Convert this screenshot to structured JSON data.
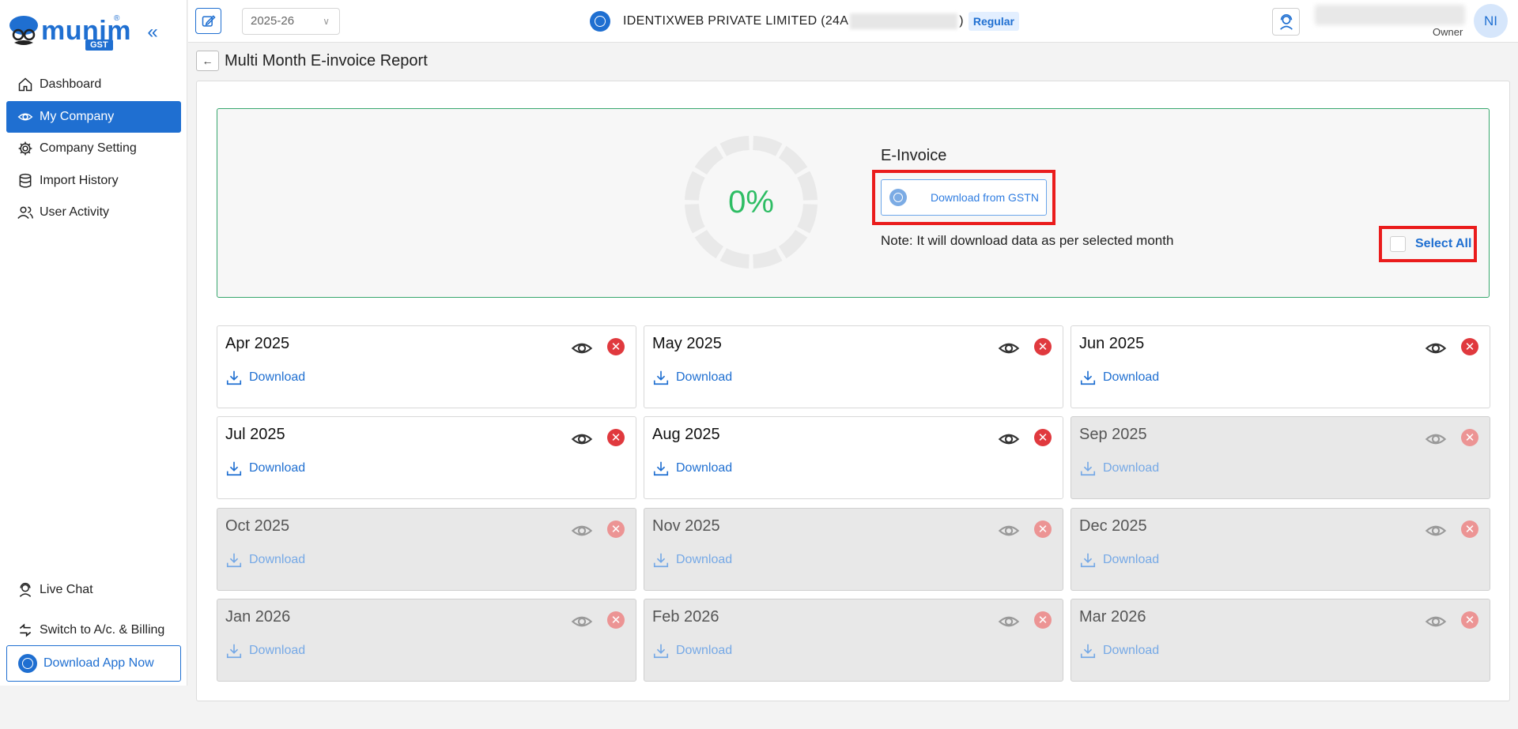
{
  "sidebar": {
    "brand": "munim",
    "brand_tag": "GST",
    "brand_mark": "®",
    "collapse": "«",
    "items": [
      {
        "label": "Dashboard"
      },
      {
        "label": "My Company"
      },
      {
        "label": "Company Setting"
      },
      {
        "label": "Import History"
      },
      {
        "label": "User Activity"
      }
    ],
    "bottom_items": [
      {
        "label": "Live Chat"
      },
      {
        "label": "Switch to A/c. & Billing"
      }
    ],
    "download_app": "Download App Now"
  },
  "header": {
    "year": "2025-26",
    "company_prefix": "IDENTIXWEB PRIVATE LIMITED (24A",
    "company_suffix": ")",
    "company_type": "Regular",
    "user_role": "Owner",
    "avatar": "NI"
  },
  "page": {
    "back": "←",
    "title": "Multi Month E-invoice Report"
  },
  "summary": {
    "progress": "0%",
    "progress_value": 0,
    "title": "E-Invoice",
    "download_gstn": "Download from GSTN",
    "note": "Note: It will download data as per selected month",
    "select_all": "Select All"
  },
  "months": [
    {
      "name": "Apr 2025",
      "download": "Download",
      "enabled": true
    },
    {
      "name": "May 2025",
      "download": "Download",
      "enabled": true
    },
    {
      "name": "Jun 2025",
      "download": "Download",
      "enabled": true
    },
    {
      "name": "Jul 2025",
      "download": "Download",
      "enabled": true
    },
    {
      "name": "Aug 2025",
      "download": "Download",
      "enabled": true
    },
    {
      "name": "Sep 2025",
      "download": "Download",
      "enabled": false
    },
    {
      "name": "Oct 2025",
      "download": "Download",
      "enabled": false
    },
    {
      "name": "Nov 2025",
      "download": "Download",
      "enabled": false
    },
    {
      "name": "Dec 2025",
      "download": "Download",
      "enabled": false
    },
    {
      "name": "Jan 2026",
      "download": "Download",
      "enabled": false
    },
    {
      "name": "Feb 2026",
      "download": "Download",
      "enabled": false
    },
    {
      "name": "Mar 2026",
      "download": "Download",
      "enabled": false
    }
  ],
  "colors": {
    "primary": "#1f6fd1",
    "success": "#2ebd64",
    "danger": "#e0393e",
    "highlight": "#ea1c1c"
  }
}
